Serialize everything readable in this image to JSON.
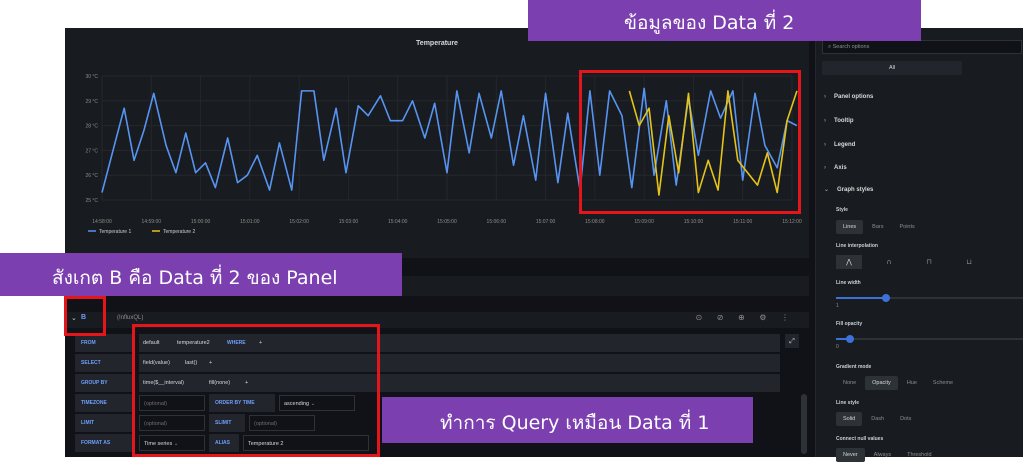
{
  "panel": {
    "title": "Temperature"
  },
  "chart_data": {
    "type": "line",
    "title": "Temperature",
    "ylim": [
      25,
      30
    ],
    "y_ticks": [
      "30 °C",
      "29 °C",
      "28 °C",
      "27 °C",
      "26 °C",
      "25 °C"
    ],
    "x_ticks": [
      "14:58:00",
      "14:59:00",
      "15:00:00",
      "15:01:00",
      "15:02:00",
      "15:03:00",
      "15:04:00",
      "15:05:00",
      "15:06:00",
      "15:07:00",
      "15:08:00",
      "15:09:00",
      "15:10:00",
      "15:11:00",
      "15:12:00"
    ],
    "grid": true,
    "legend_position": "bottom-left",
    "series": [
      {
        "name": "Temperature 1",
        "color": "#5794f2",
        "x_minutes": [
          0,
          0.25,
          0.45,
          0.65,
          0.85,
          1.05,
          1.3,
          1.5,
          1.7,
          1.9,
          2.1,
          2.3,
          2.55,
          2.75,
          2.95,
          3.15,
          3.4,
          3.6,
          3.85,
          4.05,
          4.3,
          4.5,
          4.75,
          4.95,
          5.2,
          5.4,
          5.65,
          5.85,
          6.1,
          6.3,
          6.55,
          6.75,
          7.0,
          7.2,
          7.45,
          7.65,
          7.9,
          8.1,
          8.35,
          8.55,
          8.8,
          9.0,
          9.25,
          9.45,
          9.7,
          9.9,
          10.1,
          10.3,
          10.55,
          10.75,
          11.0,
          11.2,
          11.45,
          11.65,
          11.9,
          12.1,
          12.35,
          12.55,
          12.8,
          13.0,
          13.25,
          13.45,
          13.7,
          13.9,
          14.1
        ],
        "values": [
          25.3,
          27.2,
          28.7,
          26.6,
          27.8,
          29.3,
          27.2,
          26.1,
          27.7,
          26.1,
          26.5,
          25.5,
          27.5,
          25.7,
          26.0,
          26.8,
          25.4,
          27.3,
          25.4,
          29.4,
          29.4,
          26.6,
          28.7,
          26.1,
          28.8,
          28.4,
          29.2,
          28.2,
          28.2,
          29.0,
          27.5,
          28.9,
          26.1,
          29.4,
          26.9,
          29.3,
          27.5,
          29.4,
          26.4,
          28.4,
          25.8,
          29.3,
          25.7,
          28.5,
          25.4,
          29.4,
          26.0,
          29.4,
          28.4,
          25.5,
          29.5,
          26.0,
          29.0,
          25.6,
          29.1,
          26.8,
          29.4,
          28.3,
          29.4,
          25.8,
          29.3,
          27.2,
          26.3,
          28.2,
          28.0
        ]
      },
      {
        "name": "Temperature 2",
        "color": "#e5c319",
        "x_minutes": [
          10.7,
          10.9,
          11.1,
          11.3,
          11.5,
          11.7,
          11.9,
          12.1,
          12.3,
          12.5,
          12.7,
          12.9,
          13.1,
          13.3,
          13.5,
          13.7,
          13.9,
          14.1
        ],
        "values": [
          29.4,
          28.0,
          28.7,
          25.2,
          28.4,
          26.1,
          29.3,
          25.3,
          26.6,
          25.4,
          29.4,
          26.6,
          26.1,
          25.6,
          26.9,
          25.3,
          28.2,
          29.4
        ]
      }
    ]
  },
  "query": {
    "letter": "B",
    "datasource": "(InfluxQL)",
    "toolbar_icons": "⊙ ⊘ ⊕ ⚙ ⋮",
    "rows": {
      "from": {
        "label": "FROM",
        "policy": "default",
        "measurement": "temperature2",
        "where": "WHERE",
        "add": "+"
      },
      "select": {
        "label": "SELECT",
        "field": "field(value)",
        "agg": "last()",
        "add": "+"
      },
      "group_by": {
        "label": "GROUP BY",
        "time": "time($__interval)",
        "fill": "fill(none)",
        "add": "+"
      },
      "timezone": {
        "label": "TIMEZONE",
        "placeholder": "(optional)",
        "order_label": "ORDER BY TIME",
        "order_value": "ascending"
      },
      "limit": {
        "label": "LIMIT",
        "placeholder": "(optional)",
        "slimit_label": "SLIMIT",
        "slimit_placeholder": "(optional)"
      },
      "format_as": {
        "label": "FORMAT AS",
        "value": "Time series",
        "alias_label": "ALIAS",
        "alias_value": "Temperature 2"
      }
    }
  },
  "sidebar": {
    "search_placeholder": "Search options",
    "all_tab": "All",
    "sections": [
      "Panel options",
      "Tooltip",
      "Legend",
      "Axis",
      "Graph styles"
    ],
    "style_label": "Style",
    "style_options": [
      "Lines",
      "Bars",
      "Points"
    ],
    "style_selected": "Lines",
    "interp_label": "Line interpolation",
    "interp_icons": [
      "⋀",
      "∩",
      "⊓",
      "⊔"
    ],
    "line_width_label": "Line width",
    "line_width_value": "1",
    "fill_opacity_label": "Fill opacity",
    "fill_opacity_value": "0",
    "gradient_label": "Gradient mode",
    "gradient_options": [
      "None",
      "Opacity",
      "Hue",
      "Scheme"
    ],
    "gradient_selected": "Opacity",
    "line_style_label": "Line style",
    "line_style_options": [
      "Solid",
      "Dash",
      "Dots"
    ],
    "line_style_selected": "Solid",
    "connect_label": "Connect null values",
    "connect_options": [
      "Never",
      "Always",
      "Threshold"
    ]
  },
  "callouts": {
    "top": "ข้อมูลของ Data ที่ 2",
    "left": "สังเกต B คือ Data ที่ 2 ของ Panel",
    "right": "ทำการ Query เหมือน Data ที่ 1"
  },
  "colors": {
    "callout": "#7b3fb0",
    "highlight": "#e4151b",
    "series1": "#5794f2",
    "series2": "#e5c319"
  }
}
